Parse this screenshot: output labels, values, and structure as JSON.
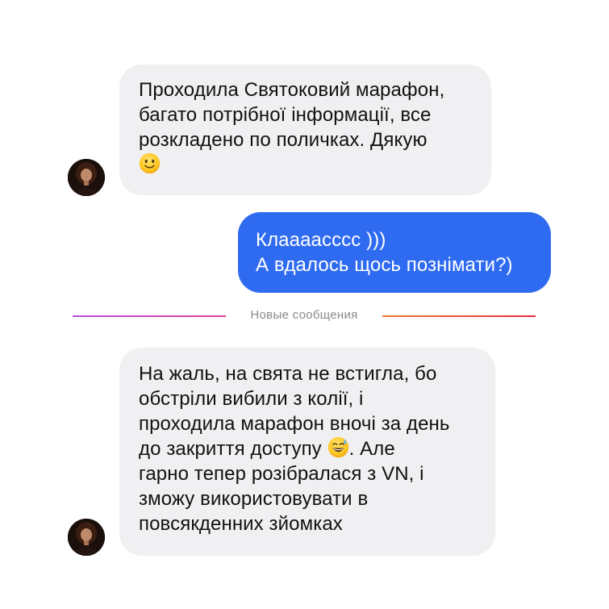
{
  "conversation": {
    "messages": [
      {
        "direction": "incoming",
        "lines": [
          "Проходила Святоковий марафон,",
          "багато потрібної інформації, все",
          "розкладено по поличках. Дякую"
        ],
        "trailing_emoji": "slightly-smiling-face"
      },
      {
        "direction": "outgoing",
        "lines": [
          "Клааааcccc )))",
          "А вдалось щось познімати?)"
        ]
      },
      {
        "direction": "incoming",
        "lines": [
          "На жаль, на свята не встигла, бо",
          "обстріли вибили з колії, і",
          "проходила марафон вночі за день",
          "до закриття доступу",
          "гарно тепер розібралася з VN, і",
          "зможу використовувати в",
          "повсякденних зйомках"
        ],
        "line4_suffix": ". Але",
        "inline_emoji": "grinning-face-with-sweat"
      }
    ],
    "divider_label": "Новые сообщения"
  },
  "colors": {
    "incoming_bubble": "#f0f0f3",
    "outgoing_bubble": "#2f6bf0",
    "text_dark": "#111111",
    "text_light": "#ffffff",
    "divider_text": "#8a8a8e"
  }
}
